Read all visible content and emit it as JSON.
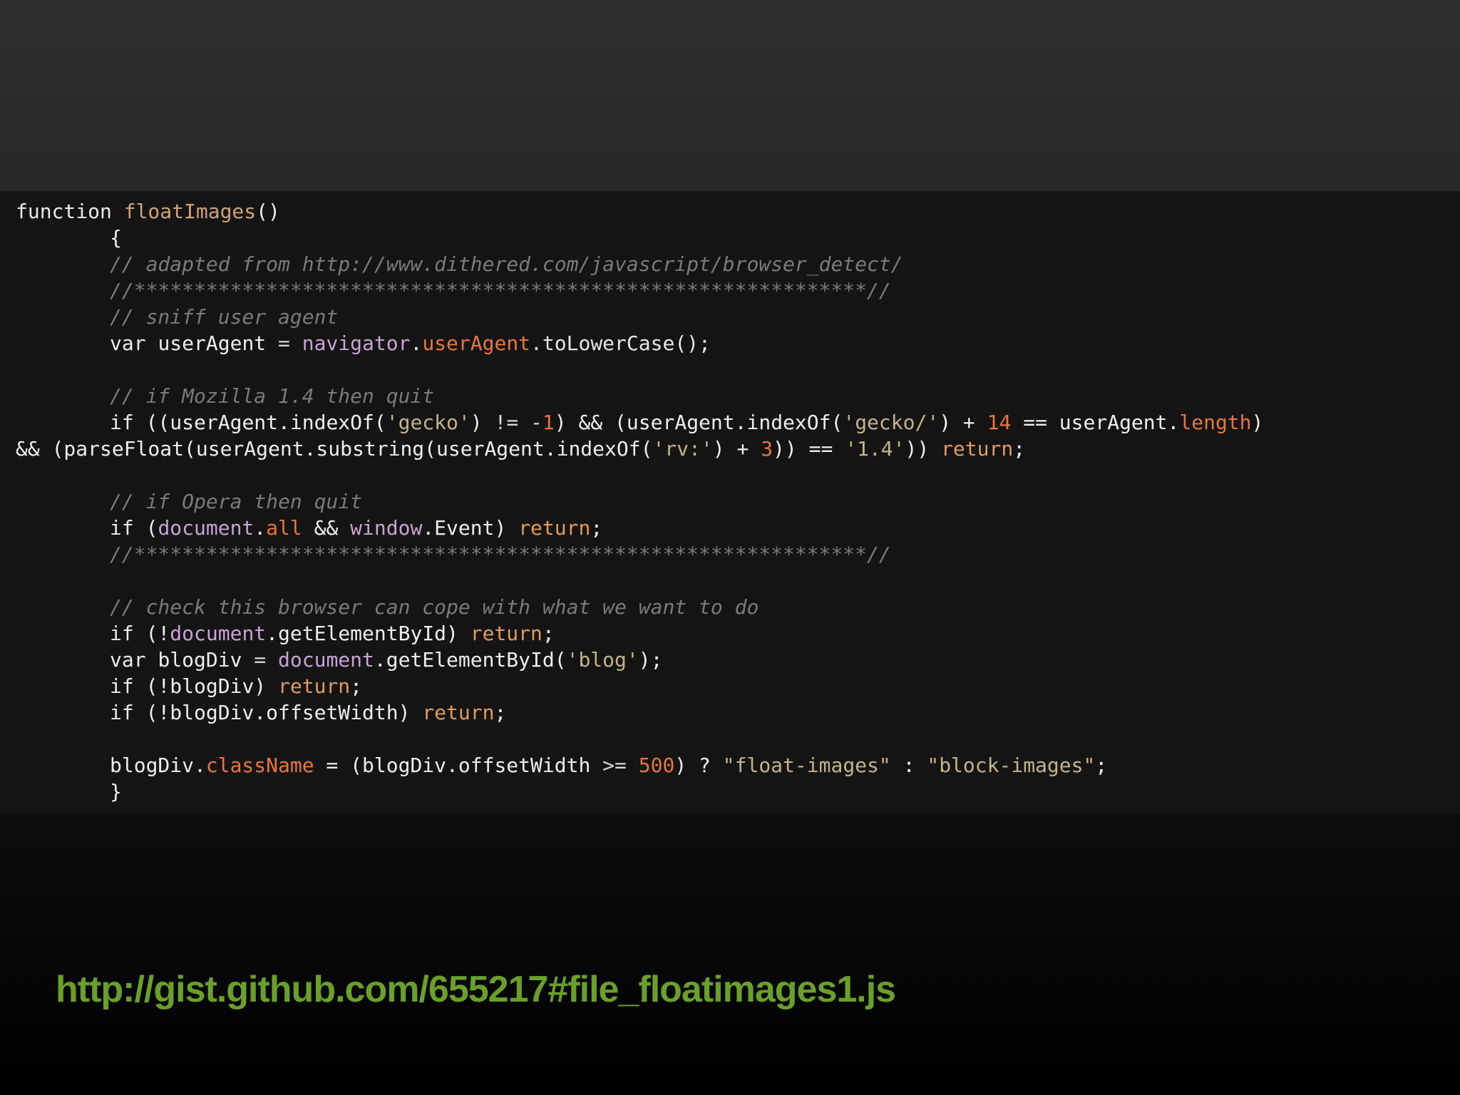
{
  "slide": {
    "link_text": "http://gist.github.com/655217#file_floatimages1.js"
  },
  "code": {
    "lines": [
      {
        "tokens": [
          {
            "t": "function ",
            "c": "kw"
          },
          {
            "t": "floatImages",
            "c": "fn"
          },
          {
            "t": "()",
            "c": "pl"
          }
        ],
        "indent": 0
      },
      {
        "tokens": [
          {
            "t": "{",
            "c": "pl"
          }
        ],
        "indent": 1
      },
      {
        "tokens": [
          {
            "t": "// adapted from http://www.dithered.com/javascript/browser_detect/",
            "c": "cm"
          }
        ],
        "indent": 1
      },
      {
        "tokens": [
          {
            "t": "//*************************************************************//",
            "c": "cm"
          }
        ],
        "indent": 1
      },
      {
        "tokens": [
          {
            "t": "// sniff user agent",
            "c": "cm"
          }
        ],
        "indent": 1
      },
      {
        "tokens": [
          {
            "t": "var ",
            "c": "kw"
          },
          {
            "t": "userAgent ",
            "c": "pl"
          },
          {
            "t": "= ",
            "c": "op"
          },
          {
            "t": "navigator",
            "c": "obj"
          },
          {
            "t": ".",
            "c": "pl"
          },
          {
            "t": "userAgent",
            "c": "prop"
          },
          {
            "t": ".toLowerCase();",
            "c": "meth"
          }
        ],
        "indent": 1
      },
      {
        "tokens": [],
        "indent": 1
      },
      {
        "tokens": [
          {
            "t": "// if Mozilla 1.4 then quit",
            "c": "cm"
          }
        ],
        "indent": 1
      },
      {
        "tokens": [
          {
            "t": "if ",
            "c": "kw"
          },
          {
            "t": "((userAgent.indexOf(",
            "c": "pl"
          },
          {
            "t": "'gecko'",
            "c": "str"
          },
          {
            "t": ") ",
            "c": "pl"
          },
          {
            "t": "!= -",
            "c": "op"
          },
          {
            "t": "1",
            "c": "num"
          },
          {
            "t": ") && (userAgent.indexOf(",
            "c": "pl"
          },
          {
            "t": "'gecko/'",
            "c": "str"
          },
          {
            "t": ") + ",
            "c": "pl"
          },
          {
            "t": "14",
            "c": "num"
          },
          {
            "t": " == userAgent.",
            "c": "pl"
          },
          {
            "t": "length",
            "c": "prop"
          },
          {
            "t": ")",
            "c": "pl"
          }
        ],
        "indent": 1
      },
      {
        "tokens": [
          {
            "t": "&& (parseFloat(userAgent.substring(userAgent.indexOf(",
            "c": "pl"
          },
          {
            "t": "'rv:'",
            "c": "str"
          },
          {
            "t": ") + ",
            "c": "pl"
          },
          {
            "t": "3",
            "c": "num"
          },
          {
            "t": ")) == ",
            "c": "pl"
          },
          {
            "t": "'1.4'",
            "c": "str"
          },
          {
            "t": ")) ",
            "c": "pl"
          },
          {
            "t": "return",
            "c": "ret"
          },
          {
            "t": ";",
            "c": "pl"
          }
        ],
        "indent": 0
      },
      {
        "tokens": [],
        "indent": 1
      },
      {
        "tokens": [
          {
            "t": "// if Opera then quit",
            "c": "cm"
          }
        ],
        "indent": 1
      },
      {
        "tokens": [
          {
            "t": "if ",
            "c": "kw"
          },
          {
            "t": "(",
            "c": "pl"
          },
          {
            "t": "document",
            "c": "obj"
          },
          {
            "t": ".",
            "c": "pl"
          },
          {
            "t": "all",
            "c": "prop"
          },
          {
            "t": " && ",
            "c": "pl"
          },
          {
            "t": "window",
            "c": "obj"
          },
          {
            "t": ".Event) ",
            "c": "pl"
          },
          {
            "t": "return",
            "c": "ret"
          },
          {
            "t": ";",
            "c": "pl"
          }
        ],
        "indent": 1
      },
      {
        "tokens": [
          {
            "t": "//*************************************************************//",
            "c": "cm"
          }
        ],
        "indent": 1
      },
      {
        "tokens": [],
        "indent": 1
      },
      {
        "tokens": [
          {
            "t": "// check this browser can cope with what we want to do",
            "c": "cm"
          }
        ],
        "indent": 1
      },
      {
        "tokens": [
          {
            "t": "if ",
            "c": "kw"
          },
          {
            "t": "(!",
            "c": "pl"
          },
          {
            "t": "document",
            "c": "obj"
          },
          {
            "t": ".getElementById) ",
            "c": "pl"
          },
          {
            "t": "return",
            "c": "ret"
          },
          {
            "t": ";",
            "c": "pl"
          }
        ],
        "indent": 1
      },
      {
        "tokens": [
          {
            "t": "var ",
            "c": "kw"
          },
          {
            "t": "blogDiv ",
            "c": "pl"
          },
          {
            "t": "= ",
            "c": "op"
          },
          {
            "t": "document",
            "c": "obj"
          },
          {
            "t": ".getElementById(",
            "c": "pl"
          },
          {
            "t": "'blog'",
            "c": "str"
          },
          {
            "t": ");",
            "c": "pl"
          }
        ],
        "indent": 1
      },
      {
        "tokens": [
          {
            "t": "if ",
            "c": "kw"
          },
          {
            "t": "(!blogDiv) ",
            "c": "pl"
          },
          {
            "t": "return",
            "c": "ret"
          },
          {
            "t": ";",
            "c": "pl"
          }
        ],
        "indent": 1
      },
      {
        "tokens": [
          {
            "t": "if ",
            "c": "kw"
          },
          {
            "t": "(!blogDiv.offsetWidth) ",
            "c": "pl"
          },
          {
            "t": "return",
            "c": "ret"
          },
          {
            "t": ";",
            "c": "pl"
          }
        ],
        "indent": 1
      },
      {
        "tokens": [],
        "indent": 1
      },
      {
        "tokens": [
          {
            "t": "blogDiv.",
            "c": "pl"
          },
          {
            "t": "className",
            "c": "prop"
          },
          {
            "t": " = (blogDiv.offsetWidth ",
            "c": "pl"
          },
          {
            "t": ">= ",
            "c": "op"
          },
          {
            "t": "500",
            "c": "num"
          },
          {
            "t": ") ? ",
            "c": "pl"
          },
          {
            "t": "\"float-images\"",
            "c": "str"
          },
          {
            "t": " : ",
            "c": "pl"
          },
          {
            "t": "\"block-images\"",
            "c": "str"
          },
          {
            "t": ";",
            "c": "pl"
          }
        ],
        "indent": 1
      },
      {
        "tokens": [
          {
            "t": "}",
            "c": "pl"
          }
        ],
        "indent": 1
      }
    ]
  },
  "colors": {
    "link": "#6aa02a",
    "code_background": "#141414",
    "comment": "#7a7a7a",
    "string": "#c3b487",
    "number_property": "#e8763c"
  }
}
